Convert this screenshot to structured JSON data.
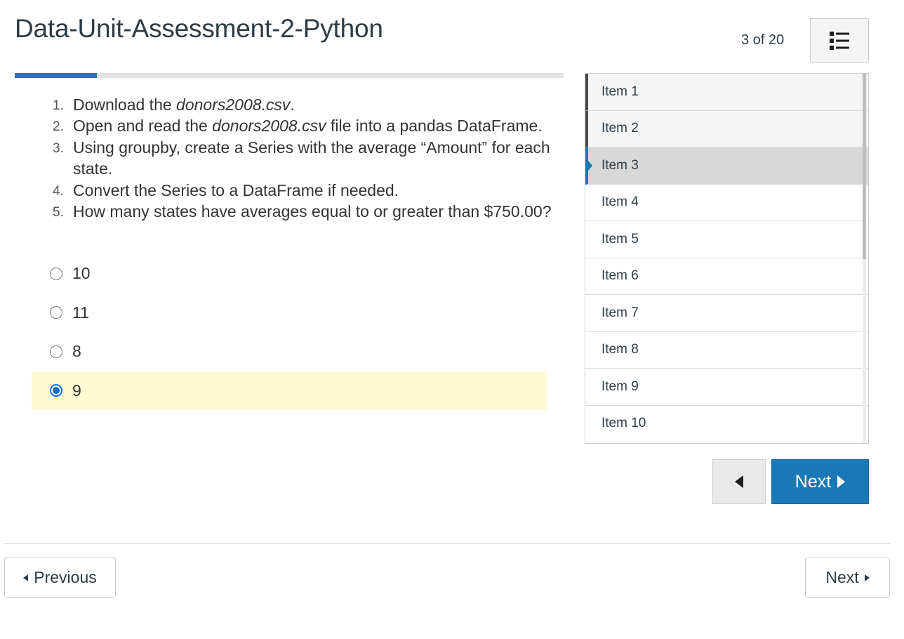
{
  "quiz": {
    "title": "Data-Unit-Assessment-2-Python",
    "counter": "3 of 20",
    "progress_fraction": 0.15,
    "accent_color": "#1a78b6"
  },
  "question": {
    "steps": [
      {
        "before": "Download the ",
        "em": "donors2008.csv",
        "after": "."
      },
      {
        "before": "Open and read the ",
        "em": "donors2008.csv",
        "after": " file into a pandas DataFrame."
      },
      {
        "before": "Using groupby, create a Series with the average “Amount” for each state.",
        "em": "",
        "after": ""
      },
      {
        "before": "Convert the Series to a DataFrame if needed.",
        "em": "",
        "after": ""
      },
      {
        "before": "How many states have averages equal to or greater than $750.00?",
        "em": "",
        "after": ""
      }
    ],
    "answers": [
      {
        "label": "10",
        "selected": false
      },
      {
        "label": "11",
        "selected": false
      },
      {
        "label": "8",
        "selected": false
      },
      {
        "label": "9",
        "selected": true
      }
    ],
    "selected_highlight_color": "#fdfad4"
  },
  "item_list": {
    "items": [
      {
        "label": "Item 1",
        "state": "seen"
      },
      {
        "label": "Item 2",
        "state": "seen"
      },
      {
        "label": "Item 3",
        "state": "current"
      },
      {
        "label": "Item 4",
        "state": ""
      },
      {
        "label": "Item 5",
        "state": ""
      },
      {
        "label": "Item 6",
        "state": ""
      },
      {
        "label": "Item 7",
        "state": ""
      },
      {
        "label": "Item 8",
        "state": ""
      },
      {
        "label": "Item 9",
        "state": ""
      },
      {
        "label": "Item 10",
        "state": ""
      }
    ]
  },
  "nav": {
    "next_label": "Next"
  },
  "footer": {
    "previous_label": "Previous",
    "next_label": "Next"
  }
}
